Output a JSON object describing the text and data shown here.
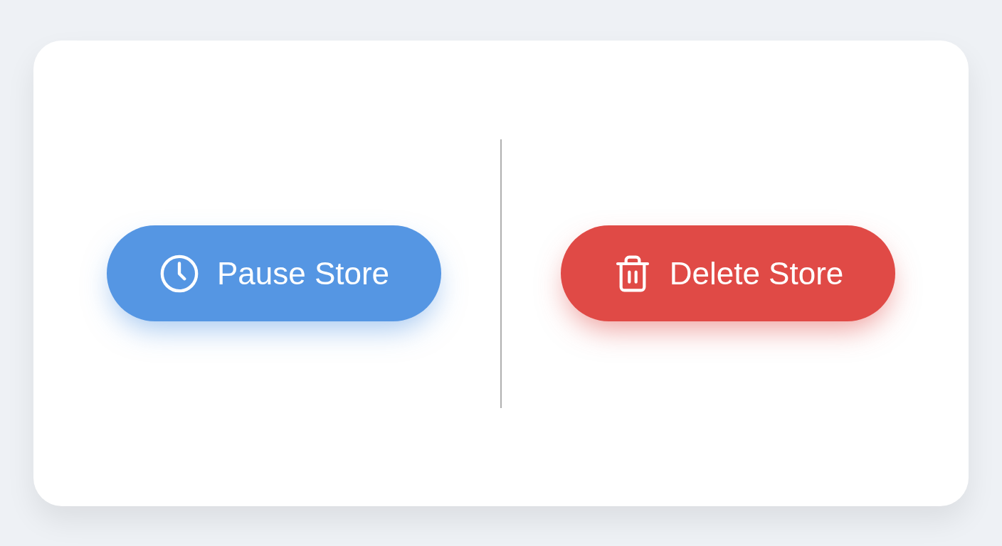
{
  "buttons": [
    {
      "kind": "pause",
      "label": "Pause Store",
      "color": "#5596e3"
    },
    {
      "kind": "delete",
      "label": "Delete Store",
      "color": "#e04a46"
    }
  ]
}
